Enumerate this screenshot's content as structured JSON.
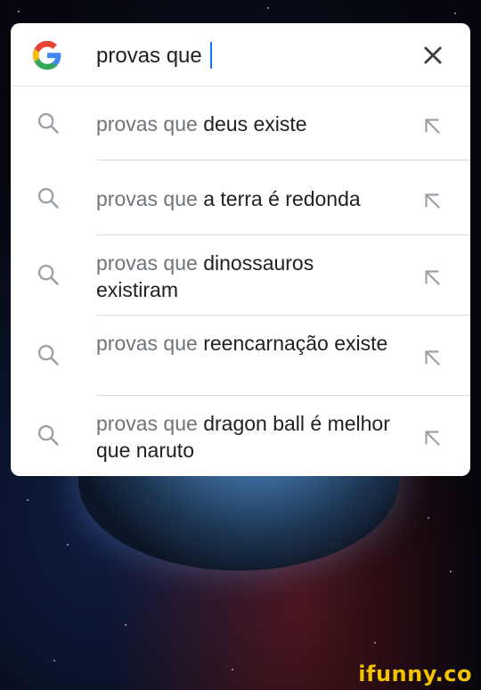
{
  "search": {
    "query": "provas que",
    "logo": "google-g-icon",
    "clear_icon": "close-icon"
  },
  "suggestions": [
    {
      "prefix": "provas que",
      "rest": "deus existe"
    },
    {
      "prefix": "provas que",
      "rest": "a terra é redonda"
    },
    {
      "prefix": "provas que",
      "rest": "dinossauros existiram"
    },
    {
      "prefix": "provas que",
      "rest": "reencarnação existe"
    },
    {
      "prefix": "provas que",
      "rest": "dragon ball é melhor que naruto"
    }
  ],
  "watermark": "ifunny.co",
  "colors": {
    "card": "#ffffff",
    "text": "#202124",
    "prefix": "#70757a",
    "cursor": "#1a73e8",
    "watermark": "#f2c400"
  }
}
